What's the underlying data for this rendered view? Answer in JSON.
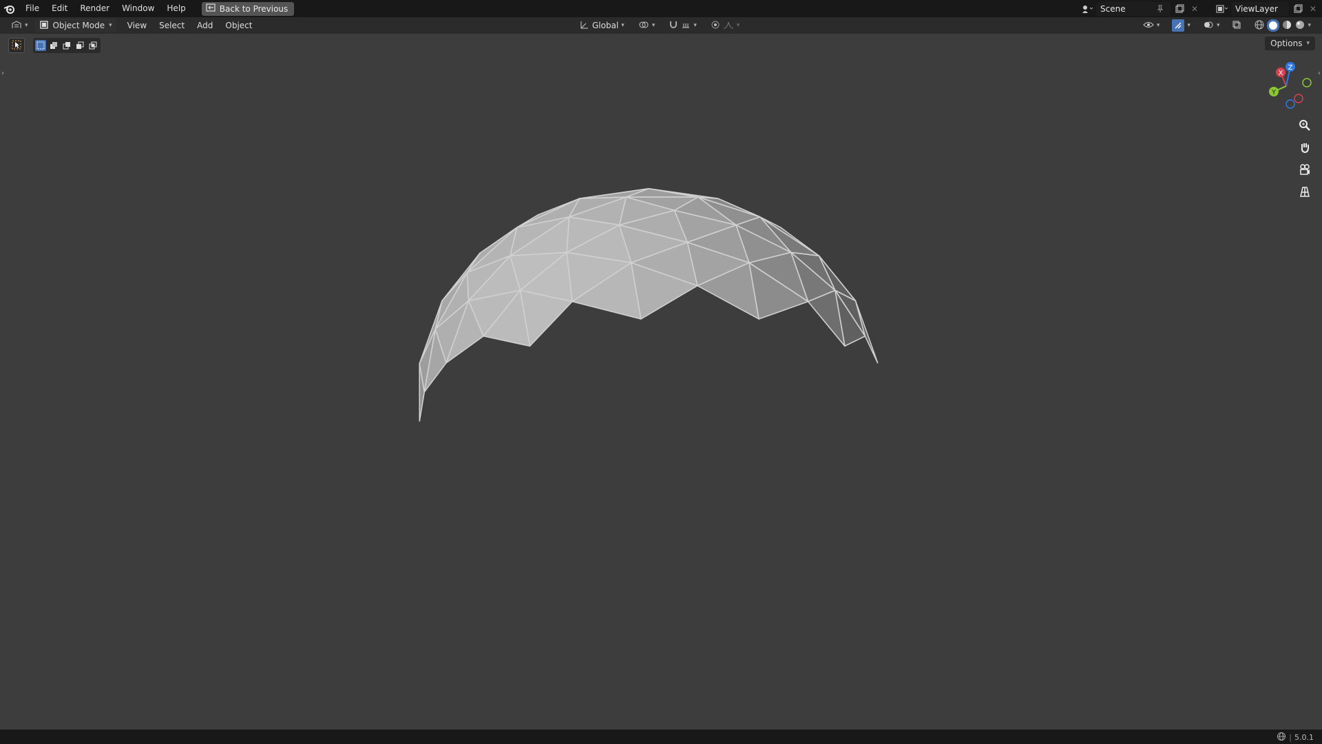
{
  "topbar": {
    "menus": [
      "File",
      "Edit",
      "Render",
      "Window",
      "Help"
    ],
    "back_button": "Back to Previous",
    "scene": "Scene",
    "view_layer": "ViewLayer"
  },
  "header": {
    "mode": "Object Mode",
    "menus": [
      "View",
      "Select",
      "Add",
      "Object"
    ],
    "transform_orientation": "Global"
  },
  "viewport": {
    "options_label": "Options",
    "gizmo": {
      "x": "X",
      "y": "Y",
      "z": "Z"
    },
    "object": "icosphere-hemisphere"
  },
  "statusbar": {
    "version": "5.0.1"
  },
  "colors": {
    "topbar": "#181818",
    "header": "#2b2b2b",
    "viewport": "#3d3d3d",
    "accent": "#4772b3",
    "axis_x": "#d9404f",
    "axis_y": "#8cc832",
    "axis_z": "#2f7ae5"
  }
}
